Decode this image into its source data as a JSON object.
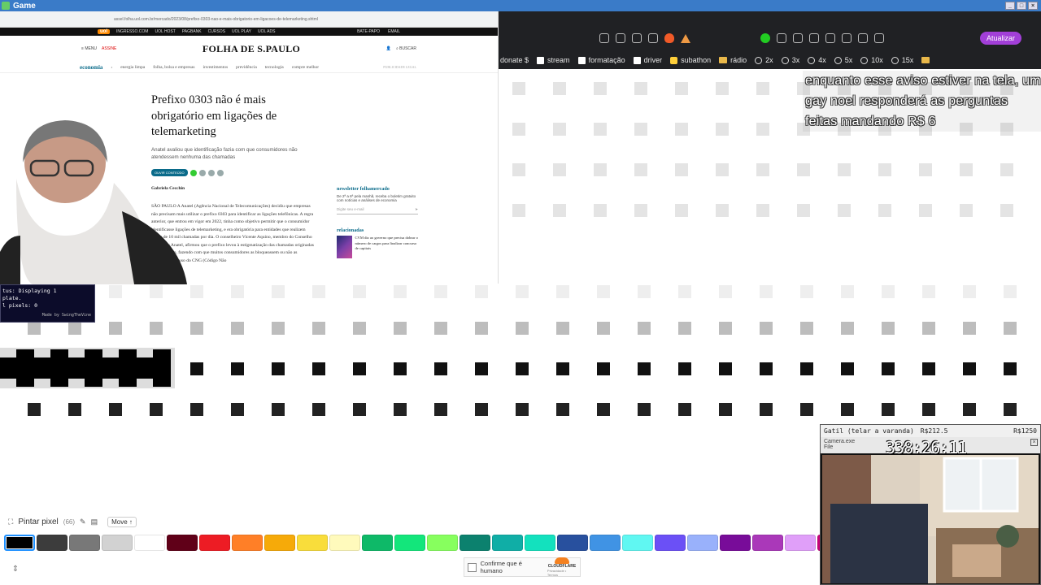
{
  "window": {
    "title": "Game"
  },
  "embedded_page": {
    "url": "assel.folha.uol.com.br/mercado/2023/08/prefixo-0303-nao-e-mais-obrigatorio-em-ligacoes-de-telemarketing.shtml",
    "uol_bar": {
      "logo": "uol",
      "items": [
        "INGRESSO.COM",
        "UOL HOST",
        "PAGBANK",
        "CURSOS",
        "UOL PLAY",
        "UOL ADS"
      ],
      "right": [
        "BATE-PAPO",
        "EMAIL"
      ]
    },
    "header": {
      "menu": "MENU",
      "assine": "ASSINE",
      "logo": "FOLHA DE S.PAULO",
      "search": "BUSCAR"
    },
    "nav": {
      "section": "economia",
      "items": [
        "energia limpa",
        "folha, bolsa e empresas",
        "investimentos",
        "previdência",
        "tecnologia",
        "compre melhor"
      ],
      "pub": "PUBLICIDADE LEGAL"
    },
    "headline": "Prefixo 0303 não é mais obrigatório em ligações de telemarketing",
    "subhead": "Anatel avaliou que identificação fazia com que consumidores não atendessem nenhuma das chamadas",
    "share_label": "OUVIR CONTEÚDO",
    "author": "Gabriela Cecchin",
    "body": "SÃO PAULO A Anatel (Agência Nacional de Telecomunicações) decidiu que empresas não precisam mais utilizar o prefixo 0303 para identificar as ligações telefônicas. A regra anterior, que entrou em vigor em 2022, tinha como objetivo permitir que o consumidor identificasse ligações de telemarketing, e era obrigatória para entidades que realizem acima de 10 mil chamadas por dia. O conselheiro Vicente Aquino, membro do Conselho Diretor da Anatel, afirmou que o prefixo levou à estigmatização das chamadas originadas com o código, fazendo com que muitos consumidores as bloqueassem ou não as atendessem. O uso do CNG (Código Não",
    "newsletter": {
      "title": "newsletter folhamercado",
      "desc": "De 2ª a 6ª pela manhã, receba o boletim gratuito com notícias e análises de economia",
      "placeholder": "Digite seu e-mail"
    },
    "related": {
      "title": "relacionadas",
      "item": "CVM diz ao governo que precisa dobrar o número de cargos para finalizar concurso de capitais"
    }
  },
  "browser": {
    "update_label": "Atualizar",
    "bookmarks": [
      "donate $",
      "stream",
      "formatação",
      "driver",
      "subathon",
      "rádio",
      "2x",
      "3x",
      "4x",
      "5x",
      "10x",
      "15x"
    ]
  },
  "terminal": {
    "lines": [
      "tus: Displaying 1",
      "plate.",
      "l pixels: 0"
    ],
    "credit": "Made by SwingTheVine"
  },
  "overlay": {
    "text": "enquanto esse aviso estiver na tela, um gay noel responderá as perguntas feitas mandando R$ 6"
  },
  "pixel_toolbar": {
    "label": "Pintar pixel",
    "count": "(66)",
    "move_label": "Move ↑"
  },
  "palette": [
    "#000000",
    "#3c3c3c",
    "#787878",
    "#d2d2d2",
    "#ffffff",
    "#600018",
    "#ed1c24",
    "#ff7f27",
    "#f6aa09",
    "#f9dd3b",
    "#fffabc",
    "#0eb968",
    "#13e67b",
    "#87ff5e",
    "#0c816e",
    "#10aea6",
    "#13e1be",
    "#28509e",
    "#4093e4",
    "#60f7f2",
    "#6b50f6",
    "#99b1fb",
    "#780c99",
    "#aa38b9",
    "#e09ff9",
    "#cb007a"
  ],
  "captcha": {
    "label": "Confirme que é humano",
    "brand": "CLOUDFLARE",
    "links": "Privacidade • Termos"
  },
  "cam": {
    "title": "Gatil (telar a varanda)",
    "title_highlight": "Gatil",
    "price1": "R$212.5",
    "price2": "R$1250",
    "sub": "Camera.exe",
    "menu": "File",
    "timer": "338:26:11"
  }
}
